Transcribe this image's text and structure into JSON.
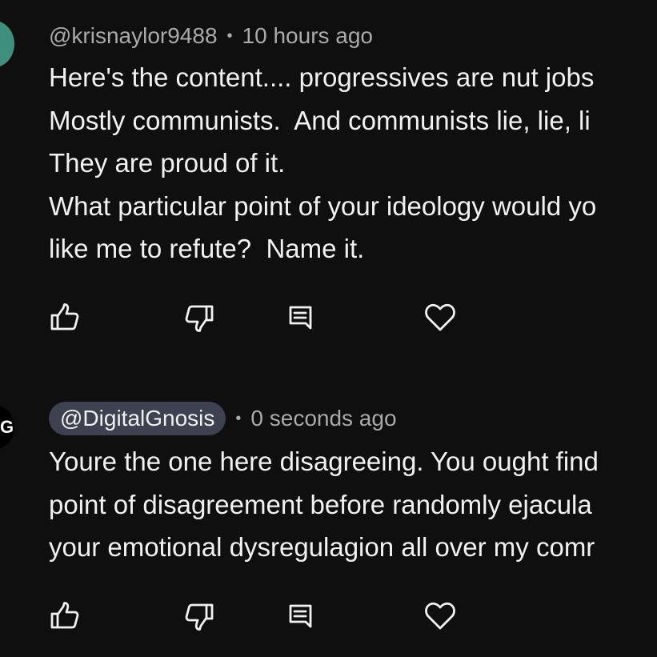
{
  "comments": [
    {
      "handle": "@krisnaylor9488",
      "separator": "•",
      "time": "10 hours ago",
      "lines": [
        "Here's the content.... progressives are nut jobs",
        "Mostly communists.  And communists lie, lie, li",
        "They are proud of it.",
        "What particular point of your ideology would yo",
        "like me to refute?  Name it."
      ],
      "actions": [
        "thumbs-up-icon",
        "thumbs-down-icon",
        "reply-icon",
        "heart-icon"
      ]
    },
    {
      "handle": "@DigitalGnosis",
      "separator": "•",
      "time": "0 seconds ago",
      "lines": [
        "Youre the one here disagreeing. You ought find",
        "point of disagreement before randomly ejacula",
        "your emotional dysregulagion all over my comr"
      ],
      "actions": [
        "thumbs-up-icon",
        "thumbs-down-icon",
        "reply-icon",
        "heart-icon"
      ]
    }
  ],
  "colors": {
    "background": "#0f0f0f",
    "text_primary": "#f1f1f1",
    "text_secondary": "#aaaaaa",
    "handle_pill": "#3e4150",
    "avatar_1": "#3f8f7e"
  }
}
